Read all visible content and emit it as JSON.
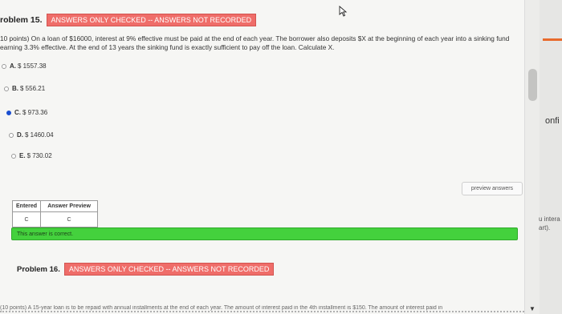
{
  "problem": {
    "title": "roblem 15.",
    "status": "ANSWERS ONLY CHECKED -- ANSWERS NOT RECORDED",
    "text_line1": "10 points) On a loan of $16000, interest at 9% effective must be paid at the end of each year. The borrower also deposits $X at the beginning of each year into a sinking fund",
    "text_line2": "earning 3.3% effective. At the end of 13 years the sinking fund is exactly sufficient to pay off the loan. Calculate X."
  },
  "options": [
    {
      "letter": "A.",
      "value": "$ 1557.38",
      "selected": false
    },
    {
      "letter": "B.",
      "value": "$ 556.21",
      "selected": false
    },
    {
      "letter": "C.",
      "value": "$ 973.36",
      "selected": true
    },
    {
      "letter": "D.",
      "value": "$ 1460.04",
      "selected": false
    },
    {
      "letter": "E.",
      "value": "$ 730.02",
      "selected": false
    }
  ],
  "preview_button": "preview answers",
  "answer_table": {
    "headers": [
      "Entered",
      "Answer Preview"
    ],
    "row": [
      "C",
      "C"
    ]
  },
  "feedback": "This answer is correct.",
  "next_problem": {
    "title": "Problem 16.",
    "status": "ANSWERS ONLY CHECKED -- ANSWERS NOT RECORDED",
    "text": "(10 points) A 15-year loan is to be repaid with annual installments at the end of each year. The amount of interest paid in the 4th installment is $150. The amount of interest paid in"
  },
  "side": {
    "text1": "onfi",
    "text2": "u intera",
    "text3": "art)."
  },
  "colors": {
    "banner": "#ef6d69",
    "correct": "#44d13d",
    "radio_selected": "#1a4fd1",
    "tab_accent": "#e86a2c"
  }
}
